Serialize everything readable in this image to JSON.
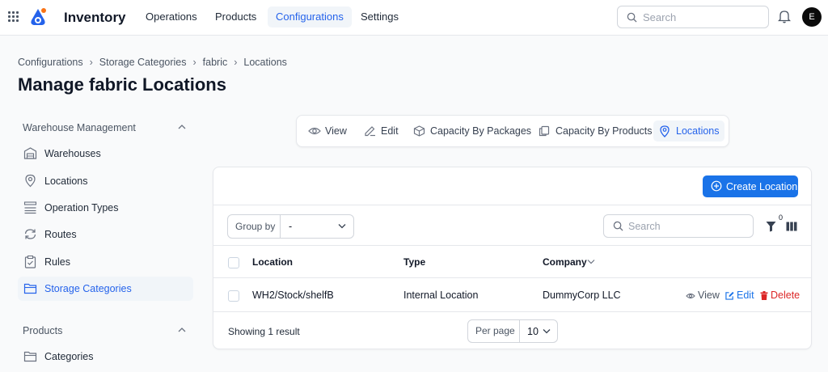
{
  "app": {
    "title": "Inventory"
  },
  "nav": [
    {
      "label": "Operations",
      "active": false
    },
    {
      "label": "Products",
      "active": false
    },
    {
      "label": "Configurations",
      "active": true
    },
    {
      "label": "Settings",
      "active": false
    }
  ],
  "header": {
    "search_placeholder": "Search",
    "avatar_initial": "E"
  },
  "breadcrumb": [
    "Configurations",
    "Storage Categories",
    "fabric",
    "Locations"
  ],
  "page": {
    "title": "Manage fabric Locations"
  },
  "sidebar": {
    "section1": {
      "title": "Warehouse Management"
    },
    "items": [
      {
        "label": "Warehouses",
        "icon": "warehouse-icon"
      },
      {
        "label": "Locations",
        "icon": "map-pin-icon"
      },
      {
        "label": "Operation Types",
        "icon": "list-icon"
      },
      {
        "label": "Routes",
        "icon": "refresh-icon"
      },
      {
        "label": "Rules",
        "icon": "clipboard-check-icon"
      },
      {
        "label": "Storage Categories",
        "icon": "folder-icon",
        "active": true
      }
    ],
    "section2": {
      "title": "Products"
    },
    "items2": [
      {
        "label": "Categories",
        "icon": "folder-icon"
      }
    ]
  },
  "tabs": [
    {
      "label": "View",
      "icon": "eye-icon"
    },
    {
      "label": "Edit",
      "icon": "pencil-icon"
    },
    {
      "label": "Capacity By Packages",
      "icon": "package-icon"
    },
    {
      "label": "Capacity By Products",
      "icon": "copy-icon"
    },
    {
      "label": "Locations",
      "icon": "map-pin-icon",
      "active": true
    }
  ],
  "toolbar": {
    "create_label": "Create Location",
    "group_by_label": "Group by",
    "group_by_value": "-",
    "search_placeholder": "Search",
    "filter_count": "0"
  },
  "table": {
    "columns": [
      "Location",
      "Type",
      "Company"
    ],
    "rows": [
      {
        "location": "WH2/Stock/shelfB",
        "type": "Internal Location",
        "company": "DummyCorp LLC"
      }
    ],
    "actions": {
      "view": "View",
      "edit": "Edit",
      "delete": "Delete"
    }
  },
  "footer": {
    "showing": "Showing 1 result",
    "per_page_label": "Per page",
    "per_page_value": "10"
  },
  "colors": {
    "accent": "#1a73e8",
    "danger": "#dc2626",
    "active_text": "#2563eb"
  }
}
